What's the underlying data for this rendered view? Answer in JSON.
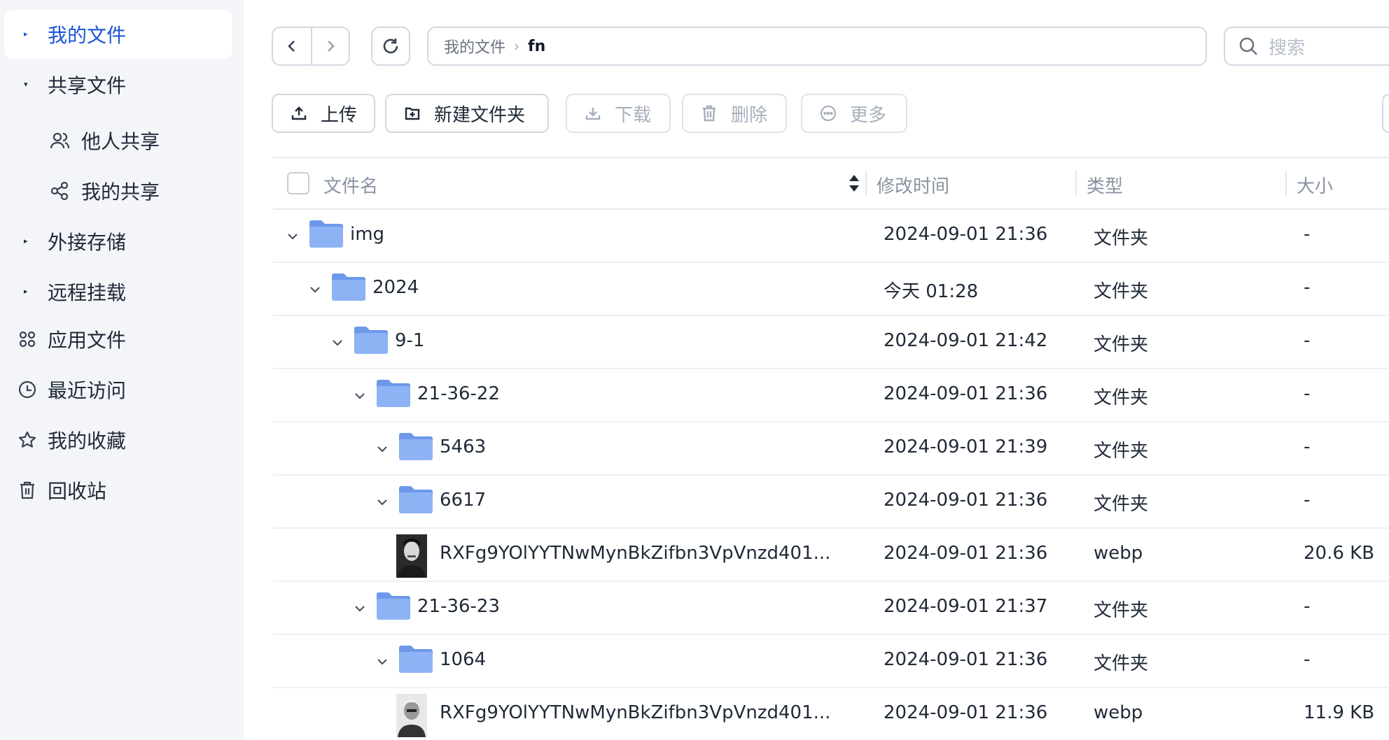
{
  "sidebar": {
    "items": [
      {
        "label": "我的文件",
        "active": true
      },
      {
        "label": "共享文件"
      },
      {
        "label": "他人共享"
      },
      {
        "label": "我的共享"
      },
      {
        "label": "外接存储"
      },
      {
        "label": "远程挂载"
      },
      {
        "label": "应用文件"
      },
      {
        "label": "最近访问"
      },
      {
        "label": "我的收藏"
      },
      {
        "label": "回收站"
      }
    ]
  },
  "breadcrumb": {
    "root": "我的文件",
    "current": "fn"
  },
  "search": {
    "placeholder": "搜索"
  },
  "toolbar": {
    "upload": "上传",
    "new_folder": "新建文件夹",
    "download": "下载",
    "delete": "删除",
    "more": "更多"
  },
  "table": {
    "headers": {
      "name": "文件名",
      "mtime": "修改时间",
      "type": "类型",
      "size": "大小"
    },
    "rows": [
      {
        "name": "img",
        "mtime": "2024-09-01 21:36",
        "type": "文件夹",
        "size": "-",
        "kind": "folder",
        "depth": 0
      },
      {
        "name": "2024",
        "mtime": "今天 01:28",
        "type": "文件夹",
        "size": "-",
        "kind": "folder",
        "depth": 1
      },
      {
        "name": "9-1",
        "mtime": "2024-09-01 21:42",
        "type": "文件夹",
        "size": "-",
        "kind": "folder",
        "depth": 2
      },
      {
        "name": "21-36-22",
        "mtime": "2024-09-01 21:36",
        "type": "文件夹",
        "size": "-",
        "kind": "folder",
        "depth": 3
      },
      {
        "name": "5463",
        "mtime": "2024-09-01 21:39",
        "type": "文件夹",
        "size": "-",
        "kind": "folder",
        "depth": 4
      },
      {
        "name": "6617",
        "mtime": "2024-09-01 21:36",
        "type": "文件夹",
        "size": "-",
        "kind": "folder",
        "depth": 4
      },
      {
        "name": "RXFg9YOlYYTNwMynBkZifbn3VpVnzd401...",
        "mtime": "2024-09-01 21:36",
        "type": "webp",
        "size": "20.6 KB",
        "kind": "file",
        "depth": 5
      },
      {
        "name": "21-36-23",
        "mtime": "2024-09-01 21:37",
        "type": "文件夹",
        "size": "-",
        "kind": "folder",
        "depth": 3
      },
      {
        "name": "1064",
        "mtime": "2024-09-01 21:36",
        "type": "文件夹",
        "size": "-",
        "kind": "folder",
        "depth": 4
      },
      {
        "name": "RXFg9YOlYYTNwMynBkZifbn3VpVnzd401...",
        "mtime": "2024-09-01 21:36",
        "type": "webp",
        "size": "11.9 KB",
        "kind": "file",
        "depth": 5
      }
    ]
  },
  "colors": {
    "accent": "#1a55d6",
    "folder": "#7fa8f0",
    "sidebar_bg": "#f3f5f9"
  }
}
